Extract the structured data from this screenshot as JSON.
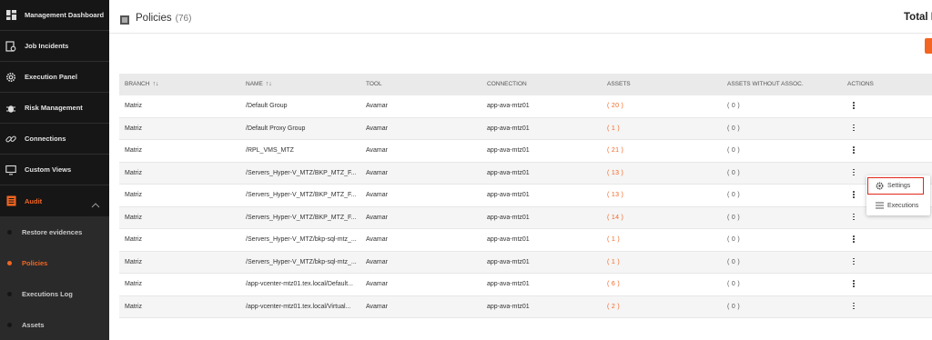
{
  "sidebar": {
    "items": [
      {
        "label": "Management Dashboard",
        "icon": "dashboard-icon"
      },
      {
        "label": "Job Incidents",
        "icon": "job-incidents-icon"
      },
      {
        "label": "Execution Panel",
        "icon": "gear-icon"
      },
      {
        "label": "Risk Management",
        "icon": "bug-icon"
      },
      {
        "label": "Connections",
        "icon": "link-icon"
      },
      {
        "label": "Custom Views",
        "icon": "monitor-icon"
      },
      {
        "label": "Audit",
        "icon": "audit-icon",
        "active": true,
        "expanded": true
      }
    ],
    "subitems": [
      {
        "label": "Restore evidences"
      },
      {
        "label": "Policies",
        "active": true
      },
      {
        "label": "Executions Log"
      },
      {
        "label": "Assets"
      }
    ]
  },
  "header": {
    "title": "Policies",
    "count": "(76)",
    "total_label": "Total E"
  },
  "table": {
    "columns": [
      "BRANCH",
      "NAME",
      "TOOL",
      "CONNECTION",
      "ASSETS",
      "ASSETS WITHOUT ASSOC.",
      "ACTIONS"
    ],
    "rows": [
      {
        "branch": "Matriz",
        "name": "/Default Group",
        "tool": "Avamar",
        "connection": "app-ava-mtz01",
        "assets": "( 20 )",
        "without": "( 0 )"
      },
      {
        "branch": "Matriz",
        "name": "/Default Proxy Group",
        "tool": "Avamar",
        "connection": "app-ava-mtz01",
        "assets": "( 1 )",
        "without": "( 0 )"
      },
      {
        "branch": "Matriz",
        "name": "/RPL_VMS_MTZ",
        "tool": "Avamar",
        "connection": "app-ava-mtz01",
        "assets": "( 21 )",
        "without": "( 0 )"
      },
      {
        "branch": "Matriz",
        "name": "/Servers_Hyper-V_MTZ/BKP_MTZ_F...",
        "tool": "Avamar",
        "connection": "app-ava-mtz01",
        "assets": "( 13 )",
        "without": "( 0 )"
      },
      {
        "branch": "Matriz",
        "name": "/Servers_Hyper-V_MTZ/BKP_MTZ_F...",
        "tool": "Avamar",
        "connection": "app-ava-mtz01",
        "assets": "( 13 )",
        "without": "( 0 )"
      },
      {
        "branch": "Matriz",
        "name": "/Servers_Hyper-V_MTZ/BKP_MTZ_F...",
        "tool": "Avamar",
        "connection": "app-ava-mtz01",
        "assets": "( 14 )",
        "without": "( 0 )"
      },
      {
        "branch": "Matriz",
        "name": "/Servers_Hyper-V_MTZ/bkp-sql-mtz_...",
        "tool": "Avamar",
        "connection": "app-ava-mtz01",
        "assets": "( 1 )",
        "without": "( 0 )"
      },
      {
        "branch": "Matriz",
        "name": "/Servers_Hyper-V_MTZ/bkp-sql-mtz_...",
        "tool": "Avamar",
        "connection": "app-ava-mtz01",
        "assets": "( 1 )",
        "without": "( 0 )"
      },
      {
        "branch": "Matriz",
        "name": "/app-vcenter-mtz01.tex.local/Default...",
        "tool": "Avamar",
        "connection": "app-ava-mtz01",
        "assets": "( 6 )",
        "without": "( 0 )"
      },
      {
        "branch": "Matriz",
        "name": "/app-vcenter-mtz01.tex.local/Virtual...",
        "tool": "Avamar",
        "connection": "app-ava-mtz01",
        "assets": "( 2 )",
        "without": "( 0 )"
      }
    ]
  },
  "menu": {
    "settings_label": "Settings",
    "executions_label": "Executions"
  },
  "colors": {
    "accent": "#f26522",
    "sidebar_bg": "#161616",
    "highlight_border": "#e0261a"
  }
}
